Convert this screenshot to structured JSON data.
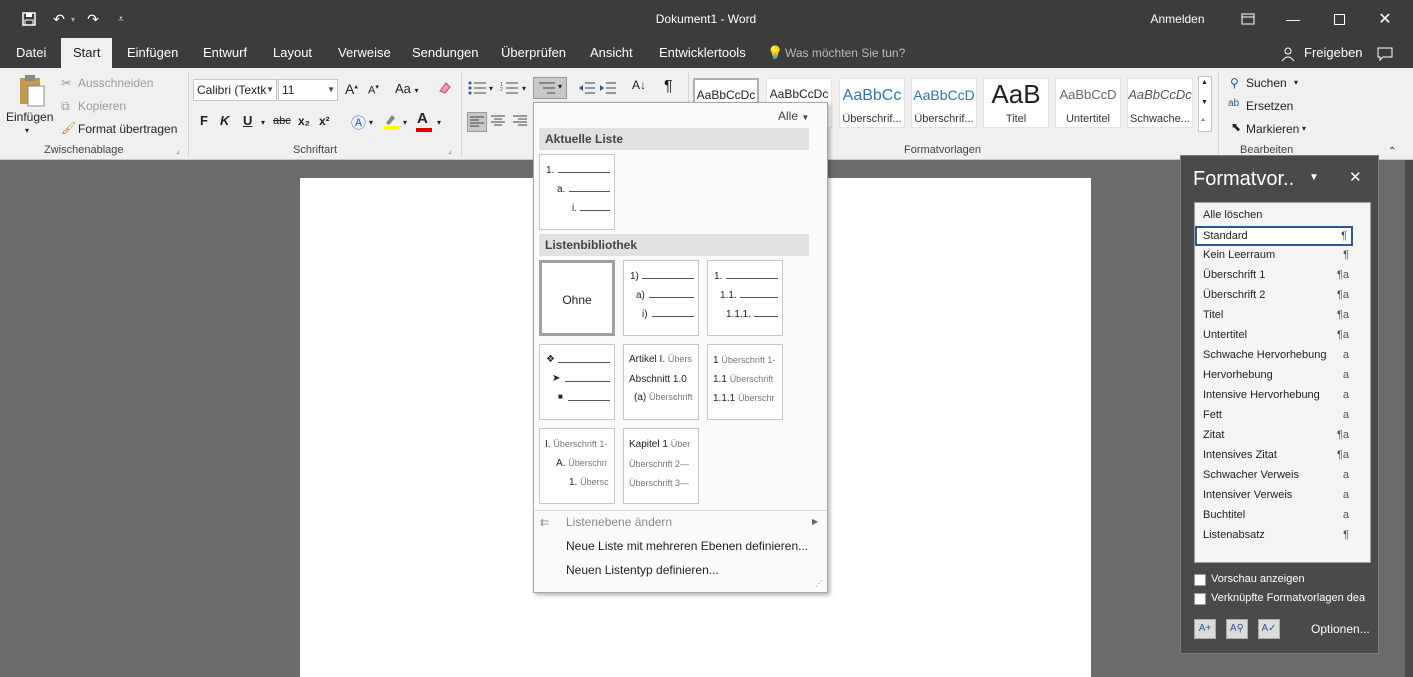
{
  "window": {
    "title": "Dokument1  -  Word",
    "signin": "Anmelden"
  },
  "tabs": [
    "Datei",
    "Start",
    "Einfügen",
    "Entwurf",
    "Layout",
    "Verweise",
    "Sendungen",
    "Überprüfen",
    "Ansicht",
    "Entwicklertools"
  ],
  "tellme": "Was möchten Sie tun?",
  "share": "Freigeben",
  "clipboard": {
    "paste": "Einfügen",
    "cut": "Ausschneiden",
    "copy": "Kopieren",
    "format_painter": "Format übertragen",
    "group": "Zwischenablage"
  },
  "font": {
    "name": "Calibri (Textk",
    "size": "11",
    "group": "Schriftart",
    "bold": "F",
    "italic": "K",
    "underline": "U",
    "strike": "abc",
    "sub": "x₂",
    "sup": "x²",
    "grow": "A",
    "shrink": "A",
    "case": "Aa",
    "color_letter": "A"
  },
  "styles_gallery": {
    "group": "Formatvorlagen",
    "items": [
      {
        "preview": "AaBbCcDc",
        "name": ""
      },
      {
        "preview": "AaBbCcDc",
        "name": ""
      },
      {
        "preview": "AaBbCc",
        "name": "Überschrif..."
      },
      {
        "preview": "AaBbCcD",
        "name": "Überschrif..."
      },
      {
        "preview": "AaB",
        "name": "Titel"
      },
      {
        "preview": "AaBbCcD",
        "name": "Untertitel"
      },
      {
        "preview": "AaBbCcDc",
        "name": "Schwache..."
      }
    ]
  },
  "editing": {
    "find": "Suchen",
    "replace": "Ersetzen",
    "select": "Markieren",
    "group": "Bearbeiten"
  },
  "list_dropdown": {
    "filter": "Alle",
    "current_header": "Aktuelle Liste",
    "library_header": "Listenbibliothek",
    "current_tile": [
      "1.",
      "a.",
      "i."
    ],
    "none_tile": "Ohne",
    "tile_paren": [
      "1)",
      "a)",
      "i)"
    ],
    "tile_decimal": [
      "1.",
      "1.1.",
      "1.1.1."
    ],
    "tile_article": [
      {
        "lead": "Artikel I.",
        "rest": "Übers"
      },
      {
        "lead": "Abschnitt 1.0",
        "rest": ""
      },
      {
        "lead": "(a)",
        "rest": "Überschrift"
      }
    ],
    "tile_heading_num": [
      {
        "lead": "1",
        "rest": "Überschrift 1-"
      },
      {
        "lead": "1.1",
        "rest": "Überschrift"
      },
      {
        "lead": "1.1.1",
        "rest": "Überschr"
      }
    ],
    "tile_roman": [
      {
        "lead": "I.",
        "rest": "Überschrift 1-"
      },
      {
        "lead": "A.",
        "rest": "Überschri"
      },
      {
        "lead": "1.",
        "rest": "Übersc"
      }
    ],
    "tile_chapter": [
      {
        "lead": "Kapitel 1",
        "rest": "Über"
      },
      {
        "lead": "",
        "rest": "Überschrift 2—"
      },
      {
        "lead": "",
        "rest": "Überschrift 3—"
      }
    ],
    "menu": {
      "change_level": "Listenebene ändern",
      "define_multilevel": "Neue Liste mit mehreren Ebenen definieren...",
      "define_style": "Neuen Listentyp definieren..."
    }
  },
  "styles_pane": {
    "title": "Formatvor..",
    "items": [
      {
        "name": "Alle löschen",
        "mark": ""
      },
      {
        "name": "Standard",
        "mark": "¶"
      },
      {
        "name": "Kein Leerraum",
        "mark": "¶"
      },
      {
        "name": "Überschrift 1",
        "mark": "¶a"
      },
      {
        "name": "Überschrift 2",
        "mark": "¶a"
      },
      {
        "name": "Titel",
        "mark": "¶a"
      },
      {
        "name": "Untertitel",
        "mark": "¶a"
      },
      {
        "name": "Schwache Hervorhebung",
        "mark": "a"
      },
      {
        "name": "Hervorhebung",
        "mark": "a"
      },
      {
        "name": "Intensive Hervorhebung",
        "mark": "a"
      },
      {
        "name": "Fett",
        "mark": "a"
      },
      {
        "name": "Zitat",
        "mark": "¶a"
      },
      {
        "name": "Intensives Zitat",
        "mark": "¶a"
      },
      {
        "name": "Schwacher Verweis",
        "mark": "a"
      },
      {
        "name": "Intensiver Verweis",
        "mark": "a"
      },
      {
        "name": "Buchtitel",
        "mark": "a"
      },
      {
        "name": "Listenabsatz",
        "mark": "¶"
      }
    ],
    "selected": "Standard",
    "preview_label": "Vorschau anzeigen",
    "linked_label": "Verknüpfte Formatvorlagen dea",
    "options": "Optionen..."
  },
  "colors": {
    "dark": "#3c3c3c",
    "ribbon": "#f0f0f0",
    "highlight": "#ffff00",
    "font_color": "#e00000",
    "selection": "#2b5797"
  }
}
